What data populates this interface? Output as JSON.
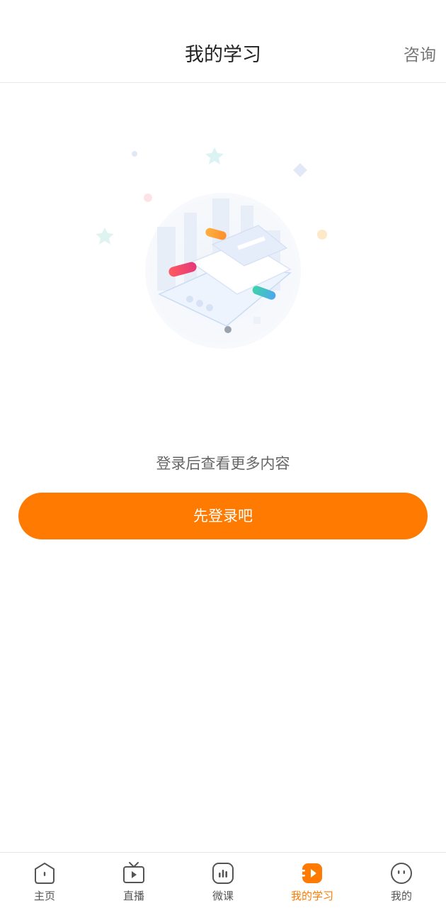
{
  "header": {
    "title": "我的学习",
    "consult_label": "咨询"
  },
  "empty_state": {
    "message": "登录后查看更多内容",
    "illustration_icon": "login-document-illustration"
  },
  "login_button": {
    "label": "先登录吧"
  },
  "tabbar": {
    "active_index": 3,
    "items": [
      {
        "label": "主页",
        "icon": "home-icon"
      },
      {
        "label": "直播",
        "icon": "tv-icon"
      },
      {
        "label": "微课",
        "icon": "chart-icon"
      },
      {
        "label": "我的学习",
        "icon": "play-tag-icon"
      },
      {
        "label": "我的",
        "icon": "face-icon"
      }
    ]
  },
  "colors": {
    "accent": "#ff7a00",
    "text": "#333333",
    "muted": "#666666"
  }
}
